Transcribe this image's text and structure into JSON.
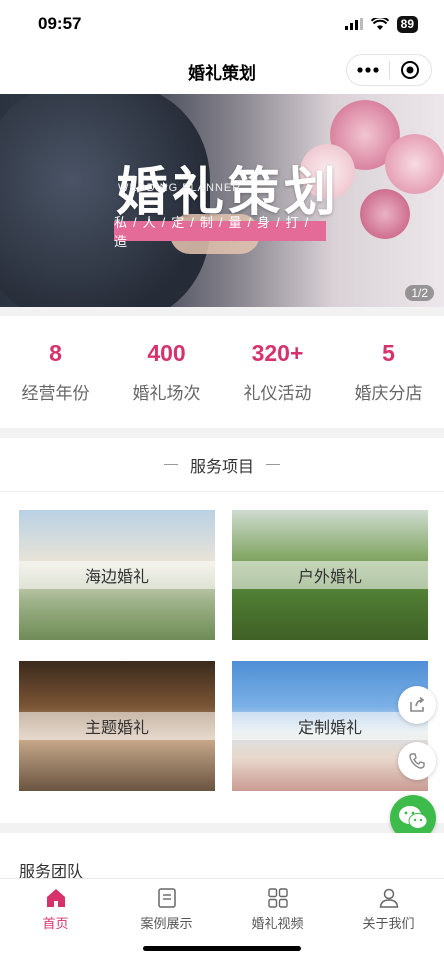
{
  "status_bar": {
    "time": "09:57",
    "battery": "89"
  },
  "nav": {
    "title": "婚礼策划"
  },
  "banner": {
    "title": "婚礼策划",
    "subtitle_en": "WEDDING PLANNER",
    "slogan": "私/人/定/制/量/身/打/造",
    "indicator": "1/2"
  },
  "stats": [
    {
      "value": "8",
      "label": "经营年份"
    },
    {
      "value": "400",
      "label": "婚礼场次"
    },
    {
      "value": "320+",
      "label": "礼仪活动"
    },
    {
      "value": "5",
      "label": "婚庆分店"
    }
  ],
  "services": {
    "title": "服务项目",
    "items": [
      {
        "label": "海边婚礼"
      },
      {
        "label": "户外婚礼"
      },
      {
        "label": "主题婚礼"
      },
      {
        "label": "定制婚礼"
      }
    ]
  },
  "team": {
    "title": "服务团队"
  },
  "tabbar": {
    "items": [
      {
        "label": "首页",
        "icon": "home-icon",
        "active": true
      },
      {
        "label": "案例展示",
        "icon": "document-icon"
      },
      {
        "label": "婚礼视频",
        "icon": "grid-icon"
      },
      {
        "label": "关于我们",
        "icon": "user-icon"
      }
    ]
  },
  "colors": {
    "accent": "#d6336c",
    "wechat": "#3dbb4b",
    "slogan_bg": "#e46a98"
  }
}
